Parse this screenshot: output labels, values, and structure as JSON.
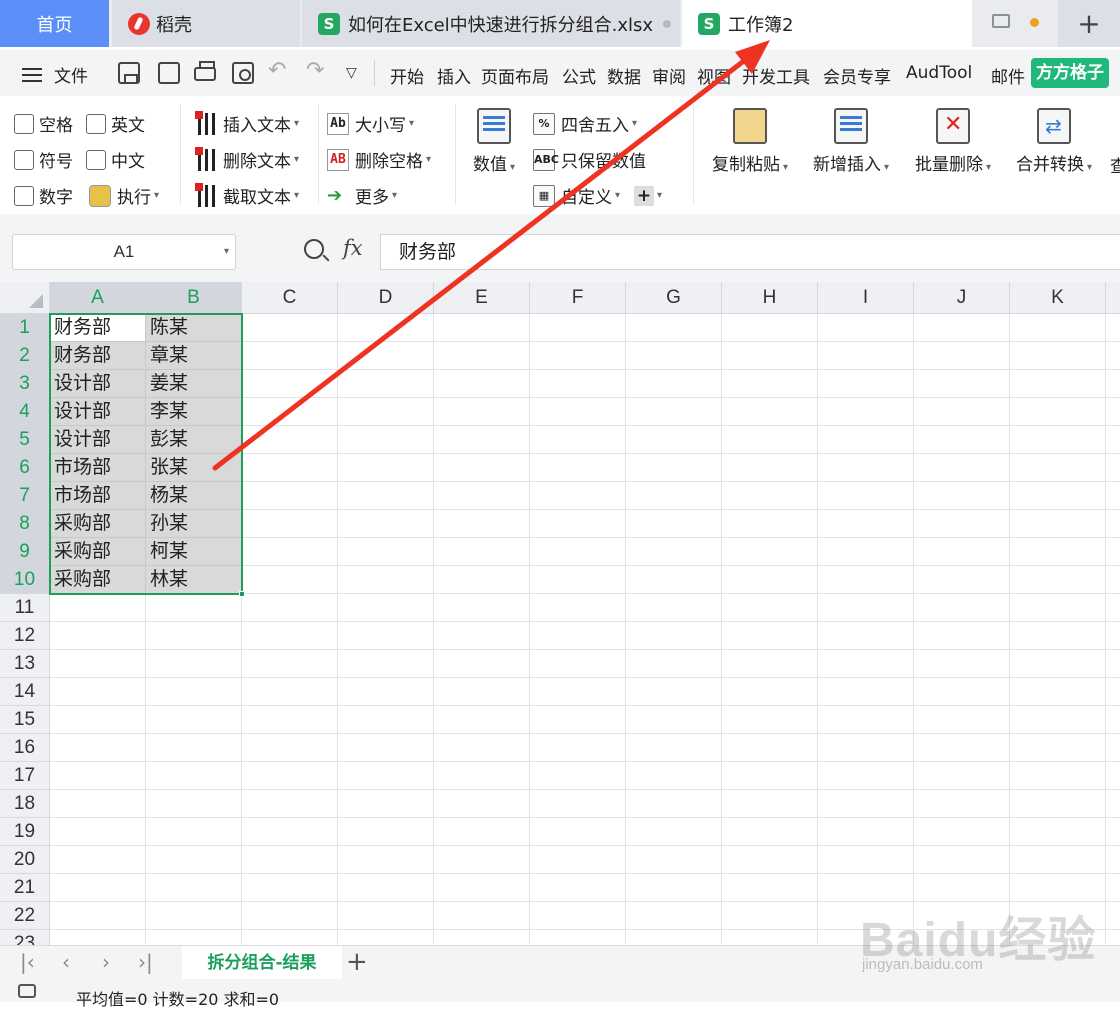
{
  "tabs": {
    "home": "首页",
    "daoke": "稻壳",
    "file1": "如何在Excel中快速进行拆分组合.xlsx",
    "file2": "工作簿2",
    "file_logo": "S"
  },
  "menu": {
    "file": "文件",
    "items": [
      "开始",
      "插入",
      "页面布局",
      "公式",
      "数据",
      "审阅",
      "视图",
      "开发工具",
      "会员专享",
      "AudTool",
      "邮件"
    ],
    "fangfang": "方方格子"
  },
  "ribbon": {
    "checks": [
      "空格",
      "英文",
      "符号",
      "中文",
      "数字"
    ],
    "exec": "执行",
    "text_ops": [
      "插入文本",
      "删除文本",
      "截取文本"
    ],
    "case_ops": [
      "大小写",
      "删除空格",
      "更多"
    ],
    "numeric": "数值",
    "round": "四舍五入",
    "keep_value": "只保留数值",
    "custom": "自定义",
    "big_buttons": [
      "复制粘贴",
      "新增插入",
      "批量删除",
      "合并转换"
    ],
    "more_cut": "查"
  },
  "formula": {
    "cell_ref": "A1",
    "fx": "fx",
    "value": "财务部"
  },
  "grid": {
    "columns": [
      "A",
      "B",
      "C",
      "D",
      "E",
      "F",
      "G",
      "H",
      "I",
      "J",
      "K"
    ],
    "rows": [
      "1",
      "2",
      "3",
      "4",
      "5",
      "6",
      "7",
      "8",
      "9",
      "10",
      "11",
      "12",
      "13",
      "14",
      "15",
      "16",
      "17",
      "18",
      "19",
      "20",
      "21",
      "22",
      "23"
    ],
    "data": [
      [
        "财务部",
        "陈某"
      ],
      [
        "财务部",
        "章某"
      ],
      [
        "设计部",
        "姜某"
      ],
      [
        "设计部",
        "李某"
      ],
      [
        "设计部",
        "彭某"
      ],
      [
        "市场部",
        "张某"
      ],
      [
        "市场部",
        "杨某"
      ],
      [
        "采购部",
        "孙某"
      ],
      [
        "采购部",
        "柯某"
      ],
      [
        "采购部",
        "林某"
      ]
    ]
  },
  "sheets": {
    "active": "拆分组合-结果"
  },
  "status": {
    "summary": "平均值=0  计数=20  求和=0"
  },
  "watermark": {
    "brand": "Baidu经验",
    "url": "jingyan.baidu.com"
  },
  "colors": {
    "accent_green": "#1aa05c",
    "home_tab_blue": "#5b8ef7",
    "annotation_arrow": "#ee3322"
  }
}
